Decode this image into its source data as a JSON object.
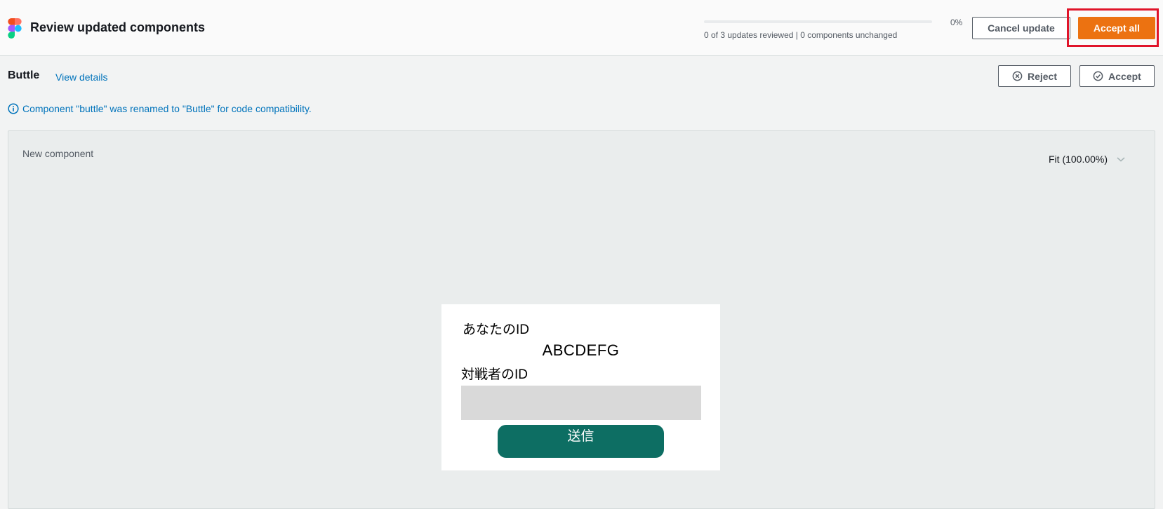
{
  "header": {
    "title": "Review updated components",
    "logo": "figma-logo",
    "progress": {
      "percent_label": "0%",
      "value": 0,
      "summary": "0 of 3 updates reviewed | 0 components unchanged"
    },
    "cancel_label": "Cancel update",
    "accept_all_label": "Accept all"
  },
  "component": {
    "name": "Buttle",
    "view_details_label": "View details",
    "reject_label": "Reject",
    "accept_label": "Accept",
    "info_message": "Component \"buttle\" was renamed to \"Buttle\" for code compatibility."
  },
  "preview": {
    "label": "New component",
    "zoom_value": "Fit (100.00%)",
    "card": {
      "your_id_label": "あなたのID",
      "your_id_value": "ABCDEFG",
      "opponent_id_label": "対戦者のID",
      "opponent_id_value": "",
      "send_label": "送信"
    }
  },
  "colors": {
    "accent": "#0073bb",
    "primary_button": "#ec7211",
    "highlight": "#e0142a",
    "send_button": "#0d6e63"
  },
  "icons": [
    "figma-logo",
    "close-circle-icon",
    "check-circle-icon",
    "info-icon",
    "chevron-down-icon"
  ]
}
